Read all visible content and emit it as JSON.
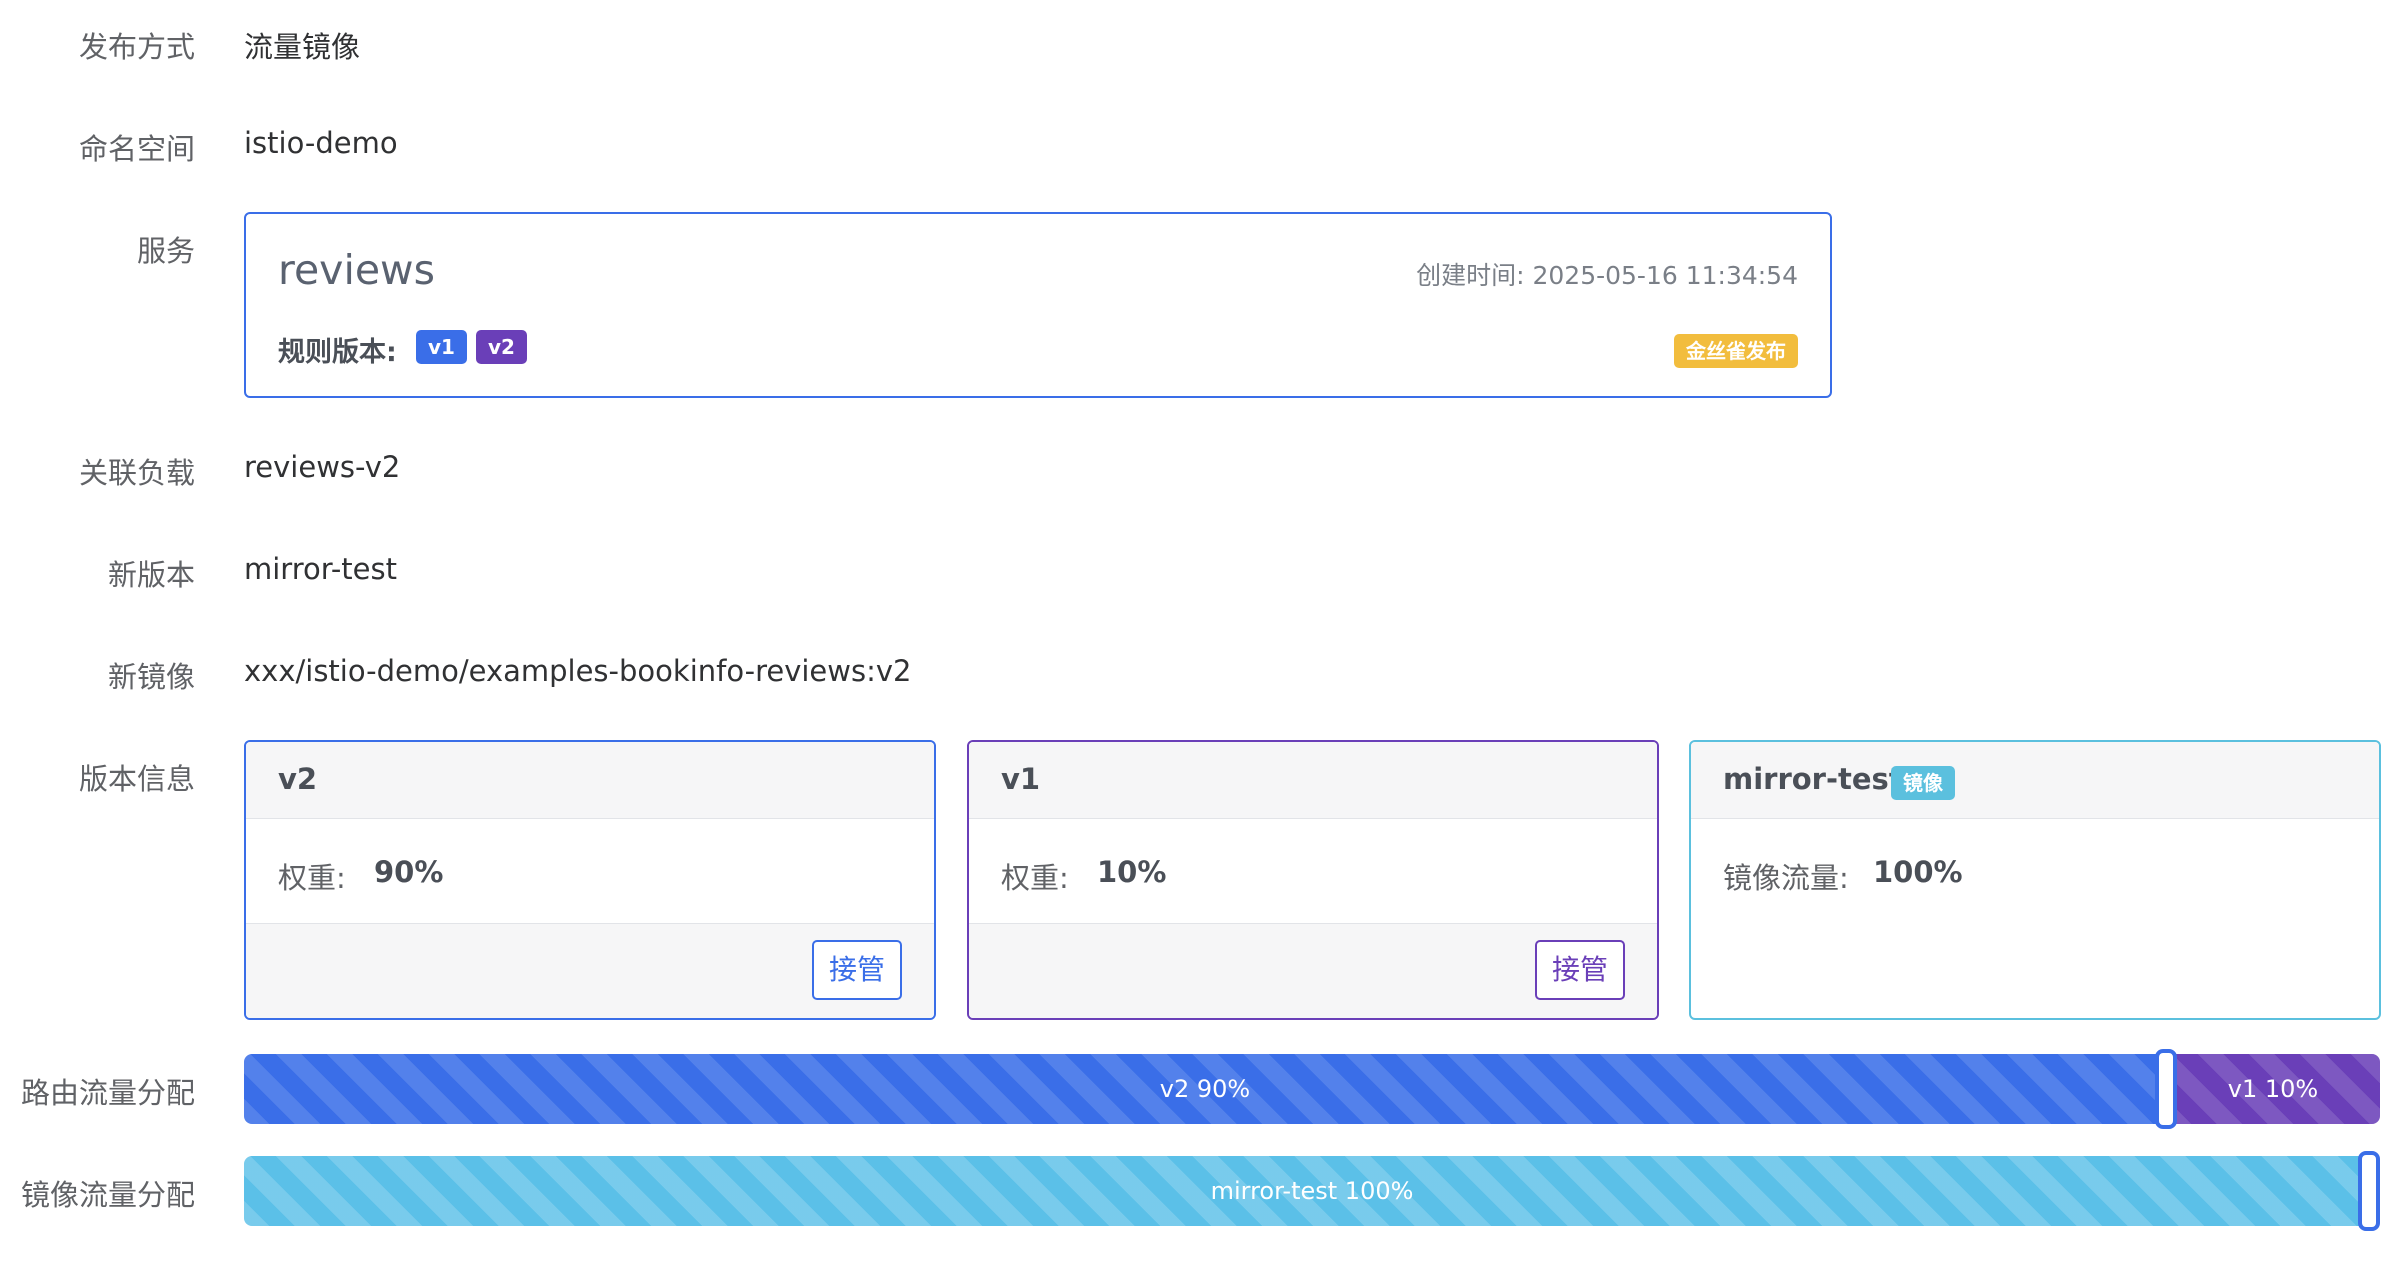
{
  "form": {
    "publish_method": {
      "label": "发布方式",
      "value": "流量镜像"
    },
    "namespace": {
      "label": "命名空间",
      "value": "istio-demo"
    },
    "service_label": "服务",
    "related_workload": {
      "label": "关联负载",
      "value": "reviews-v2"
    },
    "new_version": {
      "label": "新版本",
      "value": "mirror-test"
    },
    "new_image": {
      "label": "新镜像",
      "value": "xxx/istio-demo/examples-bookinfo-reviews:v2"
    },
    "version_info_label": "版本信息",
    "route_traffic_label": "路由流量分配",
    "mirror_traffic_label": "镜像流量分配"
  },
  "service": {
    "name": "reviews",
    "created": "创建时间: 2025-05-16 11:34:54",
    "rule_versions_label": "规则版本:",
    "rule_versions": [
      "v1",
      "v2"
    ],
    "strategy_badge": "金丝雀发布"
  },
  "versions": [
    {
      "name": "v2",
      "metric_label": "权重:",
      "metric_value": "90%",
      "action": "接管",
      "color": "#3a6ee8"
    },
    {
      "name": "v1",
      "metric_label": "权重:",
      "metric_value": "10%",
      "action": "接管",
      "color": "#6a3fb8"
    },
    {
      "name": "mirror-test",
      "tag": "镜像",
      "metric_label": "镜像流量:",
      "metric_value": "100%",
      "color": "#5bc0de"
    }
  ],
  "route_traffic": [
    {
      "label": "v2 90%",
      "percent": 90,
      "color": "#3a6ee8"
    },
    {
      "label": "v1 10%",
      "percent": 10,
      "color": "#6a3fb8"
    }
  ],
  "mirror_traffic": {
    "label": "mirror-test 100%",
    "percent": 100,
    "color": "#5bc0e8"
  }
}
